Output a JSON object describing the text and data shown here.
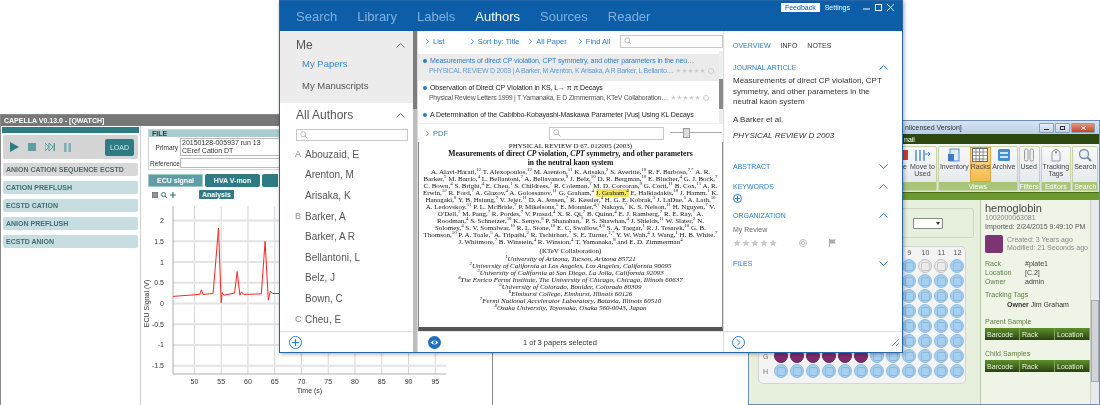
{
  "capella": {
    "title": "CAPELLA V0.13.0 - [QWATCH]",
    "load_button": "LOAD",
    "sequences": [
      {
        "label": "ANION CATION SEQUENCE ECSTD",
        "selected": true
      },
      {
        "label": "CATION PREFLUSH",
        "selected": false
      },
      {
        "label": "ECSTD CATION",
        "selected": false
      },
      {
        "label": "ANION PREFLUSH",
        "selected": false
      },
      {
        "label": "ECSTD ANION",
        "selected": false
      }
    ],
    "file": {
      "heading": "FILE",
      "primary_label": "Primary",
      "primary_value": "20150128-005937 run 13 CEref Cation DT",
      "reference_label": "Reference"
    },
    "signal_tabs": [
      {
        "label": "ECU signal",
        "selected": true
      },
      {
        "label": "HVA V-mon",
        "selected": false
      },
      {
        "selected": false
      }
    ],
    "analysis_button": "Analysis",
    "chart_data": {
      "type": "line",
      "xlabel": "Time (s)",
      "ylabel": "ECU Signal (V)",
      "grid": true,
      "x": [
        46,
        51,
        51.3,
        51.6,
        53.5,
        54.5,
        55,
        55.2,
        55.5,
        57.5,
        58,
        58.5,
        58.8,
        59.2,
        62.5,
        63.2,
        63.8,
        64.2,
        64.6,
        66
      ],
      "series": [
        {
          "color": "#ff2222",
          "values": [
            0.17,
            0.22,
            0.33,
            0.22,
            0.24,
            1.82,
            0.02,
            0.26,
            0.2,
            0.25,
            0.77,
            0.2,
            0.28,
            0.22,
            0.23,
            1.5,
            0.08,
            0.3,
            0.24,
            0.24
          ]
        }
      ],
      "xlim": [
        46,
        97
      ],
      "ylim": [
        -1.7,
        2.35
      ],
      "xticks": [
        50,
        55,
        60,
        65,
        70,
        75,
        80,
        85,
        90,
        95
      ],
      "yticks": [
        -1.5,
        -1,
        -0.5,
        0,
        0.5,
        1,
        1.5,
        2
      ]
    }
  },
  "library": {
    "nav": [
      {
        "label": "Search",
        "selected": false
      },
      {
        "label": "Library",
        "selected": false
      },
      {
        "label": "Labels",
        "selected": false
      },
      {
        "label": "Authors",
        "selected": true
      },
      {
        "label": "Sources",
        "selected": false
      },
      {
        "label": "Reader",
        "selected": false
      }
    ],
    "feedback": "Feedback",
    "settings": "Settings",
    "me": {
      "heading": "Me",
      "expanded": true,
      "items": [
        {
          "label": "My Papers",
          "selected": true
        },
        {
          "label": "My Manuscripts",
          "selected": false
        }
      ]
    },
    "all_authors": {
      "heading": "All Authors",
      "expanded": true,
      "groups": [
        {
          "letter": "A",
          "authors": [
            "Abouzaid, E",
            "Arenton, M",
            "Arisaka, K"
          ]
        },
        {
          "letter": "B",
          "authors": [
            "Barker, A",
            "Barker, A R",
            "Bellantoni, L",
            "Belz, J",
            "Bown, C"
          ]
        },
        {
          "letter": "C",
          "authors": [
            "Cheu, E"
          ]
        }
      ]
    },
    "toolbar": [
      "List",
      "Sort by: Title",
      "All Paper",
      "Find All"
    ],
    "papers": [
      {
        "title": "Measurements of direct CP violation, CPT symmetry, and other parameters in the neu…",
        "meta": "PHYSICAL REVIEW D 2003 | A Barker, M Arenton, K Arisaka, A R Barker, L Bellanto…",
        "stars": 0,
        "selected": true
      },
      {
        "title": "Observation of Direct CP Violation in KS, L→ π π Decays",
        "meta": "Physical Review Letters 1999 | T Yamanaka, E D Zimmerman, KTeV Collaboration…",
        "stars": 0,
        "selected": false
      },
      {
        "title": "A Determination of the Cabibbo-Kobayashi-Maskawa Parameter |Vus| Using KL Decays",
        "selected": false
      }
    ],
    "pdf": {
      "label": "PDF",
      "zoom": {
        "level": 0.3
      },
      "page": {
        "header": "PHYSICAL REVIEW D 67, 012005 (2003)",
        "title": [
          "Measurements of direct *CP* violation, *CPT* symmetry, and other parameters",
          "in the neutral kaon system"
        ],
        "authors": [
          {
            "text": "A. Alavi-Harati,$^{12}$ T. Alexopoulos,$^{12}$ M. Arenton,$^{11}$ K. Arisaka,$^{2}$ S. Averitte,$^{10}$ R. F. Barbosa,$^{7,*}$ A. R. Barker,$^{5}$ M. Barrio,$^{4}$ L. Bellantoni,$^{7}$ A. Bellavance,$^{9}$ J. Belz,$^{10}$ D. R. Bergman,$^{10}$ E. Blucher,$^{4}$ G. J. Bock,$^{7}$ C. Bown,$^{4}$ S. Bright,$^{4}$ E. Cheu,$^{1}$ S. Childress,$^{7}$ R. Coleman,$^{7}$ M. D. Corcoran,$^{9}$ G. Corti,$^{11}$ B. Cox,$^{11}$ A. R. Erwin,$^{12}$ R. Ford,$^{7}$ A. Glazov,$^{4}$ A. Golossanov,$^{11}$ G. Graham,$^{4}$",
            "highlighted": false
          },
          {
            "text": "J. Graham,$^{4}$",
            "highlighted": true
          },
          {
            "text": "E. Halkiadakis,$^{10}$ J. Hamm,$^{1}$ K. Hanagaki,$^{8}$ Y. B. Hsiung,$^{7}$ V. Jejer,$^{11}$ D. A. Jensen,$^{7}$ R. Kessler,$^{4}$ H. G. E. Kobrak,$^{3}$ J. LaDue,$^{5}$ A. Lath,$^{10}$ A. Ledovskoy,$^{11}$ P. L. McBride,$^{7}$ P. Mikelsons,$^{5}$ E. Monnier,$^{4,†}$ Nakaya,$^{7}$ K. S. Nelson,$^{11}$ H. Nguyen,$^{7}$ V. O'Dell,$^{7}$ M. Pang,$^{7}$ R. Pordes,$^{7}$ V. Prasad,$^{4}$ X. R. Qi,$^{7}$ B. Quinn,$^{4}$ E. J. Ramberg,$^{7}$ R. E. Ray,$^{7}$ A. Roodman,$^{4}$ S. Schnetzer,$^{10}$ K. Senyo,$^{8}$ P. Shanahan,$^{7}$ P. S. Shawhan,$^{4}$ J. Shields,$^{11}$ W. Slater,$^{2}$ N. Solomey,$^{4}$ S. V. Somalwar,$^{10}$ R. L. Stone,$^{10}$ E. C. Swallow,$^{4,6}$ S. A. Taegar,$^{1}$ R. J. Tesarek,$^{10}$ G. B. Thomson,$^{10}$ P. A. Toale,$^{5}$ A. Tripathi,$^{2}$ R. Tschirhart,$^{7}$ S. E. Turner,$^{2,*}$ Y. W. Wah,$^{4}$ J. Wang,$^{1}$ H. B. White,$^{7}$ J. Whitmore,$^{7}$ B. Winstein,$^{4}$ R. Winston,$^{4}$ T. Yamanaka,$^{8}$ and E. D. Zimmerman$^{4}$",
            "highlighted": false
          }
        ],
        "collaboration": "(KTeV Collaboration)",
        "affiliations": [
          "$^{1}$University of Arizona, Tucson, Arizona 85721",
          "$^{2}$University of California at Los Angeles, Los Angeles, California 90095",
          "$^{3}$University of California at San Diego, La Jolla, California 92093",
          "$^{4}$The Enrico Fermi Institute, The University of Chicago, Chicago, Illinois 60637",
          "$^{5}$University of Colorado, Boulder, Colorado 80309",
          "$^{6}$Elmhurst College, Elmhurst, Illinois 60126",
          "$^{7}$Fermi National Accelerator Laboratory, Batavia, Illinois 60510",
          "$^{8}$Osaka University, Toyonaka, Osaka 560-0043, Japan"
        ]
      }
    },
    "status": "1 of 3 papers selected",
    "details": {
      "tabs": [
        {
          "label": "OVERVIEW",
          "selected": true
        },
        {
          "label": "INFO",
          "selected": false
        },
        {
          "label": "NOTES",
          "selected": false
        }
      ],
      "sections": [
        {
          "kind": "article",
          "heading": "JOURNAL ARTICLE",
          "expanded": true,
          "title": "Measurements of direct CP violation, CPT symmetry, and other parameters in the neutral kaon system",
          "authors": "A Barker et al.",
          "source": "PHYSICAL REVIEW D 2003"
        },
        {
          "kind": "plain",
          "heading": "ABSTRACT",
          "expanded": false
        },
        {
          "kind": "keywords",
          "heading": "KEYWORDS",
          "expanded": true
        },
        {
          "kind": "organization",
          "heading": "ORGANIZATION",
          "expanded": true,
          "label": "My Review",
          "stars": 0
        },
        {
          "kind": "plain",
          "heading": "FILES",
          "expanded": false
        }
      ]
    }
  },
  "samples": {
    "title": "nlicensed Version]",
    "menu": "nail",
    "ribbon": [
      {
        "buttons": [
          {
            "kind": "partial",
            "label": "e",
            "selected": false
          },
          {
            "kind": "move",
            "label": "Move to Used",
            "selected": false
          }
        ]
      },
      {
        "label": "Views",
        "buttons": [
          {
            "kind": "inventory",
            "label": "Inventory",
            "selected": false
          },
          {
            "kind": "racks",
            "label": "Racks",
            "selected": true
          },
          {
            "kind": "archive",
            "label": "Archive",
            "selected": false
          }
        ]
      },
      {
        "label": "Filters",
        "buttons": [
          {
            "kind": "used",
            "label": "Used",
            "selected": false
          }
        ]
      },
      {
        "label": "Editors",
        "buttons": [
          {
            "kind": "tags",
            "label": "Tracking Tags",
            "selected": false
          }
        ]
      },
      {
        "label": "Search",
        "buttons": [
          {
            "kind": "search",
            "label": "Search",
            "selected": false
          }
        ]
      }
    ],
    "plate": {
      "columns": [
        "9",
        "10",
        "11",
        "12"
      ],
      "rows": [
        {
          "wells": [
            {
              "empty": false,
              "selected": false
            },
            {
              "empty": true,
              "selected": false
            },
            {
              "empty": true,
              "selected": false
            },
            {
              "empty": false,
              "selected": false
            }
          ]
        },
        {
          "wells": [
            {
              "empty": false,
              "selected": false
            },
            {
              "empty": false,
              "selected": false
            },
            {
              "empty": false,
              "selected": false
            },
            {
              "empty": false,
              "selected": false
            }
          ]
        },
        {
          "wells": [
            {
              "empty": false,
              "selected": false
            },
            {
              "empty": false,
              "selected": false
            },
            {
              "empty": false,
              "selected": false
            },
            {
              "empty": false,
              "selected": false
            }
          ]
        },
        {
          "wells": [
            {
              "empty": false,
              "selected": false
            },
            {
              "empty": false,
              "selected": false
            },
            {
              "empty": false,
              "selected": false
            },
            {
              "empty": false,
              "selected": false
            }
          ]
        },
        {
          "wells": [
            {
              "empty": false,
              "selected": false
            },
            {
              "empty": false,
              "selected": false
            },
            {
              "empty": false,
              "selected": false
            },
            {
              "empty": false,
              "selected": false
            }
          ]
        },
        {
          "wells": [
            {
              "empty": false,
              "selected": false
            },
            {
              "empty": false,
              "selected": false
            },
            {
              "empty": false,
              "selected": false
            },
            {
              "empty": false,
              "selected": false
            }
          ]
        },
        {
          "label": "G",
          "wells": [
            {
              "empty": false,
              "selected": true
            },
            {
              "empty": false,
              "selected": true
            },
            {
              "empty": false,
              "selected": true
            },
            {
              "empty": false,
              "selected": true
            },
            {
              "empty": false,
              "selected": true
            },
            {
              "empty": false,
              "selected": true
            },
            {
              "empty": false,
              "selected": false
            },
            {
              "empty": false,
              "selected": false
            },
            {
              "empty": false,
              "selected": false
            },
            {
              "empty": false,
              "selected": false
            },
            {
              "empty": false,
              "selected": false
            },
            {
              "empty": false,
              "selected": false
            }
          ]
        },
        {
          "label": "H",
          "wells": [
            {
              "empty": false,
              "selected": false
            },
            {
              "empty": false,
              "selected": false
            },
            {
              "empty": false,
              "selected": false
            },
            {
              "empty": false,
              "selected": false
            },
            {
              "empty": false,
              "selected": false
            },
            {
              "empty": false,
              "selected": false
            },
            {
              "empty": false,
              "selected": false
            },
            {
              "empty": false,
              "selected": false
            },
            {
              "empty": false,
              "selected": false
            },
            {
              "empty": false,
              "selected": false
            },
            {
              "empty": false,
              "selected": false
            },
            {
              "empty": false,
              "selected": false
            }
          ]
        }
      ]
    },
    "detail": {
      "name": "hemoglobin",
      "barcode": "1002000063081",
      "imported": "Imported: 2/24/2015 9:49:10 PM",
      "color": "#7b3572",
      "created": "Created: 3 Years ago",
      "modified": "Modified: 21 Seconds ago",
      "fields": [
        {
          "label": "Rack",
          "value": "#plate1"
        },
        {
          "label": "Location",
          "value": "[C.2]"
        },
        {
          "label": "Owner",
          "value": "admin"
        }
      ],
      "tracking_heading": "Tracking Tags",
      "tracking": [
        {
          "label": "Owner",
          "value": "Jim Graham"
        }
      ],
      "tables": [
        {
          "heading": "Parent Sample",
          "columns": [
            "Barcode",
            "Rack",
            "Location"
          ]
        },
        {
          "heading": "Child Samples",
          "columns": [
            "Barcode",
            "Rack",
            "Location"
          ]
        }
      ]
    }
  }
}
